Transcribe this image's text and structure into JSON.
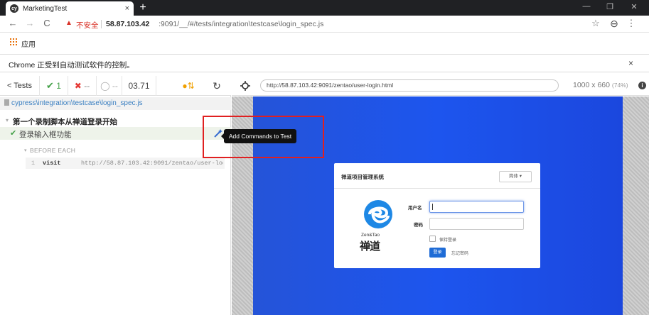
{
  "browser": {
    "tab_title": "MarketingTest",
    "tab_favicon": "cy",
    "tab_close": "×",
    "new_tab": "+",
    "window_controls": [
      "—",
      "❐",
      "✕"
    ],
    "nav": {
      "back": "←",
      "forward": "→",
      "reload": "C"
    },
    "security_warning_icon": "▲",
    "security_label": "不安全",
    "url_host": "58.87.103.42",
    "url_rest": ":9091/__/#/tests/integration\\testcase\\login_spec.js",
    "star": "☆",
    "profile": "⊖",
    "menu": "⋮",
    "bookmarks_apps_label": "应用",
    "infobar_text": "Chrome 正受到自动测试软件的控制。",
    "infobar_close": "×"
  },
  "reporter": {
    "tests_button": "< Tests",
    "passed_icon": "✔",
    "passed_count": "1",
    "failed_icon": "✖",
    "failed_count": "--",
    "pending_icon": "◯",
    "pending_count": "--",
    "duration": "03.71",
    "auto_scroll_icon": "●⇅",
    "restart_icon": "↻",
    "spec_path": "cypress\\integration\\testcase\\login_spec.js",
    "suite_caret": "▾",
    "suite_title": "第一个录制脚本从禅道登录开始",
    "test_status_icon": "✔",
    "test_title": "登录输入框功能",
    "hook_caret": "▾",
    "hook_label": "BEFORE EACH",
    "command": {
      "number": "1",
      "name": "visit",
      "arg": "http://58.87.103.42:9091/zentao/user-log.."
    },
    "tooltip": "Add Commands to Test"
  },
  "runner": {
    "url": "http://58.87.103.42:9091/zentao/user-login.html",
    "viewport": "1000 x 660",
    "zoom": "(74%)",
    "info_icon": "i"
  },
  "login_page": {
    "title": "禅道项目管理系统",
    "lang_button": "简体 ▾",
    "logo_text": "Zen&Tao",
    "logo_chinese": "禅道",
    "username_label": "用户名",
    "password_label": "密码",
    "remember_label": "保持登录",
    "login_button": "登录",
    "forgot_link": "忘记密码"
  }
}
